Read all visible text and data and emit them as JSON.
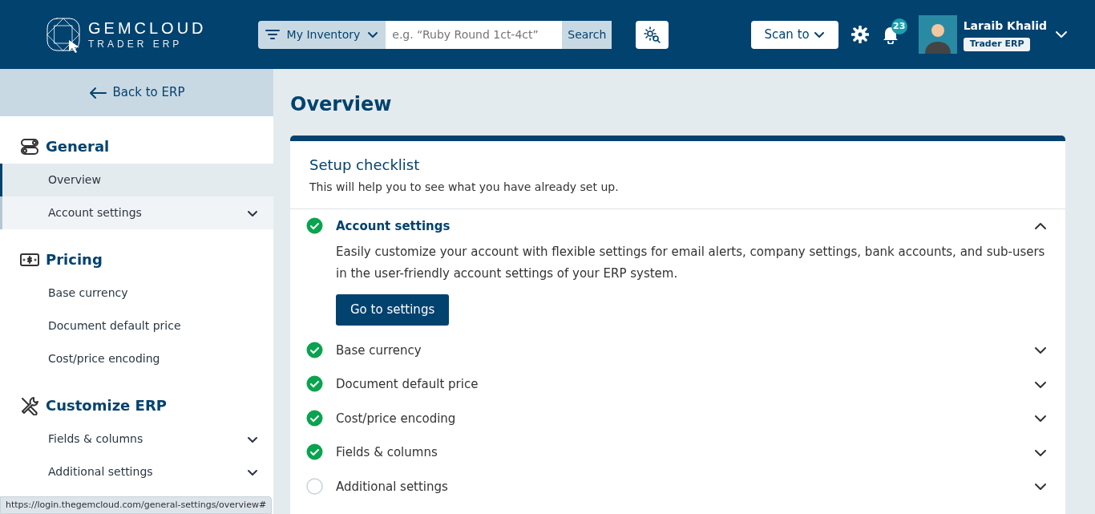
{
  "header": {
    "brand": {
      "name": "GEMCLOUD",
      "tagline": "TRADER ERP"
    },
    "search": {
      "scope": "My Inventory",
      "placeholder": "e.g. “Ruby Round 1ct-4ct”",
      "button": "Search"
    },
    "scan": "Scan to",
    "notifications": "23",
    "user": {
      "name": "Laraib Khalid",
      "role": "Trader ERP"
    }
  },
  "sidebar": {
    "back": "Back to ERP",
    "sections": [
      {
        "title": "General",
        "kind": "toggles",
        "items": [
          {
            "label": "Overview",
            "selected": true,
            "hovered": false,
            "expandable": false
          },
          {
            "label": "Account settings",
            "selected": false,
            "hovered": true,
            "expandable": true
          }
        ]
      },
      {
        "title": "Pricing",
        "kind": "money",
        "items": [
          {
            "label": "Base currency",
            "selected": false,
            "hovered": false,
            "expandable": false
          },
          {
            "label": "Document default price",
            "selected": false,
            "hovered": false,
            "expandable": false
          },
          {
            "label": "Cost/price encoding",
            "selected": false,
            "hovered": false,
            "expandable": false
          }
        ]
      },
      {
        "title": "Customize ERP",
        "kind": "tools",
        "items": [
          {
            "label": "Fields & columns",
            "selected": false,
            "hovered": false,
            "expandable": true
          },
          {
            "label": "Additional settings",
            "selected": false,
            "hovered": false,
            "expandable": true
          }
        ]
      }
    ]
  },
  "page_title": "Overview",
  "checklist": {
    "title": "Setup checklist",
    "subtitle": "This will help you to see what you have already set up.",
    "items": [
      {
        "title": "Account settings",
        "done": true,
        "expanded": true,
        "description": "Easily customize your account with flexible settings for email alerts, company settings, bank accounts, and sub-users in the user-friendly account settings of your ERP system.",
        "button": "Go to settings"
      },
      {
        "title": "Base currency",
        "done": true,
        "expanded": false
      },
      {
        "title": "Document default price",
        "done": true,
        "expanded": false
      },
      {
        "title": "Cost/price encoding",
        "done": true,
        "expanded": false
      },
      {
        "title": "Fields & columns",
        "done": true,
        "expanded": false
      },
      {
        "title": "Additional settings",
        "done": false,
        "expanded": false
      }
    ]
  },
  "status_url": "https://login.thegemcloud.com/general-settings/overview#"
}
